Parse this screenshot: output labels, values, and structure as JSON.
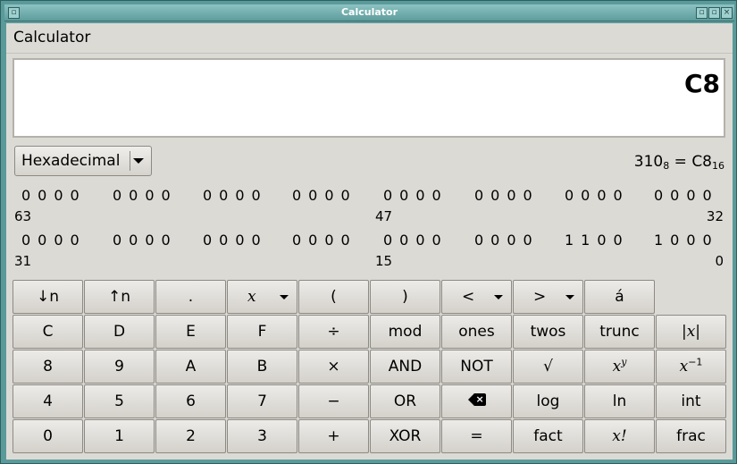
{
  "window": {
    "title": "Calculator",
    "menu_glyph": "▫",
    "min_glyph": "▫",
    "max_glyph": "▫",
    "close_glyph": "×"
  },
  "menubar": {
    "title": "Calculator"
  },
  "display": {
    "value": "C8"
  },
  "base_select": {
    "selected": "Hexadecimal"
  },
  "conversion": {
    "oct_value": "310",
    "oct_base": "8",
    "equals": " = ",
    "hex_value": "C8",
    "hex_base": "16"
  },
  "bits": {
    "row1": {
      "nibbles": [
        "0000",
        "0000",
        "0000",
        "0000",
        "0000",
        "0000",
        "0000",
        "0000"
      ],
      "pos_left": "63",
      "pos_mid": "47",
      "pos_right": "32"
    },
    "row2": {
      "nibbles": [
        "0000",
        "0000",
        "0000",
        "0000",
        "0000",
        "0000",
        "1100",
        "1000"
      ],
      "pos_left": "31",
      "pos_mid": "15",
      "pos_right": "0"
    }
  },
  "keys": {
    "row0": [
      "↓n",
      "↑n",
      ".",
      "x",
      "(",
      ")",
      "<",
      ">",
      "á"
    ],
    "row1": [
      "C",
      "D",
      "E",
      "F",
      "÷",
      "mod",
      "ones",
      "twos",
      "trunc",
      "|x|"
    ],
    "row2": [
      "8",
      "9",
      "A",
      "B",
      "×",
      "AND",
      "NOT",
      "√",
      "x",
      "x"
    ],
    "row2_sup": {
      "xy": "y",
      "xinv": "−1"
    },
    "row3": [
      "4",
      "5",
      "6",
      "7",
      "−",
      "OR",
      "⌫",
      "log",
      "ln",
      "int"
    ],
    "row4": [
      "0",
      "1",
      "2",
      "3",
      "+",
      "XOR",
      "=",
      "fact",
      "x!",
      "frac"
    ]
  }
}
